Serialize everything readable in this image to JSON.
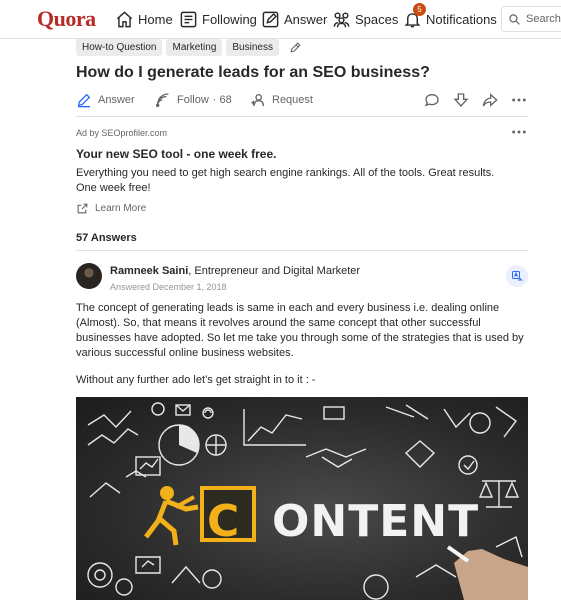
{
  "header": {
    "logo": "Quora",
    "nav": [
      {
        "label": "Home",
        "icon": "home-icon"
      },
      {
        "label": "Following",
        "icon": "following-icon"
      },
      {
        "label": "Answer",
        "icon": "answer-icon"
      },
      {
        "label": "Spaces",
        "icon": "spaces-icon"
      },
      {
        "label": "Notifications",
        "icon": "bell-icon",
        "badge": "5"
      }
    ],
    "search_placeholder": "Search Quora"
  },
  "question": {
    "topics": [
      "How-to Question",
      "Marketing",
      "Business"
    ],
    "title": "How do I generate leads for an SEO business?",
    "actions": {
      "answer": "Answer",
      "follow": "Follow",
      "follow_count": "· 68",
      "request": "Request"
    }
  },
  "ad": {
    "by": "Ad by SEOprofiler.com",
    "title": "Your new SEO tool - one week free.",
    "body": "Everything you need to get high search engine rankings. All of the tools. Great results. One week free!",
    "cta": "Learn More"
  },
  "answers_count": "57 Answers",
  "answer": {
    "author_name": "Ramneek Saini",
    "author_credential": ", Entrepreneur and Digital Marketer",
    "date": "Answered December 1, 2018",
    "paragraphs": [
      "The concept of generating leads is same in each and every business i.e. dealing online (Almost). So, that means it revolves around the same concept that other successful businesses have adopted. So let me take you through some of the strategies that is used by various successful online business websites.",
      "Without any further ado let’s get straight in to it : -"
    ],
    "image": {
      "c_letter": "C",
      "word": "ONTENT",
      "accent": "#f2b019"
    }
  },
  "colors": {
    "brand": "#b92b27",
    "badge": "#cb4b10",
    "text": "#282829",
    "muted": "#636466"
  }
}
